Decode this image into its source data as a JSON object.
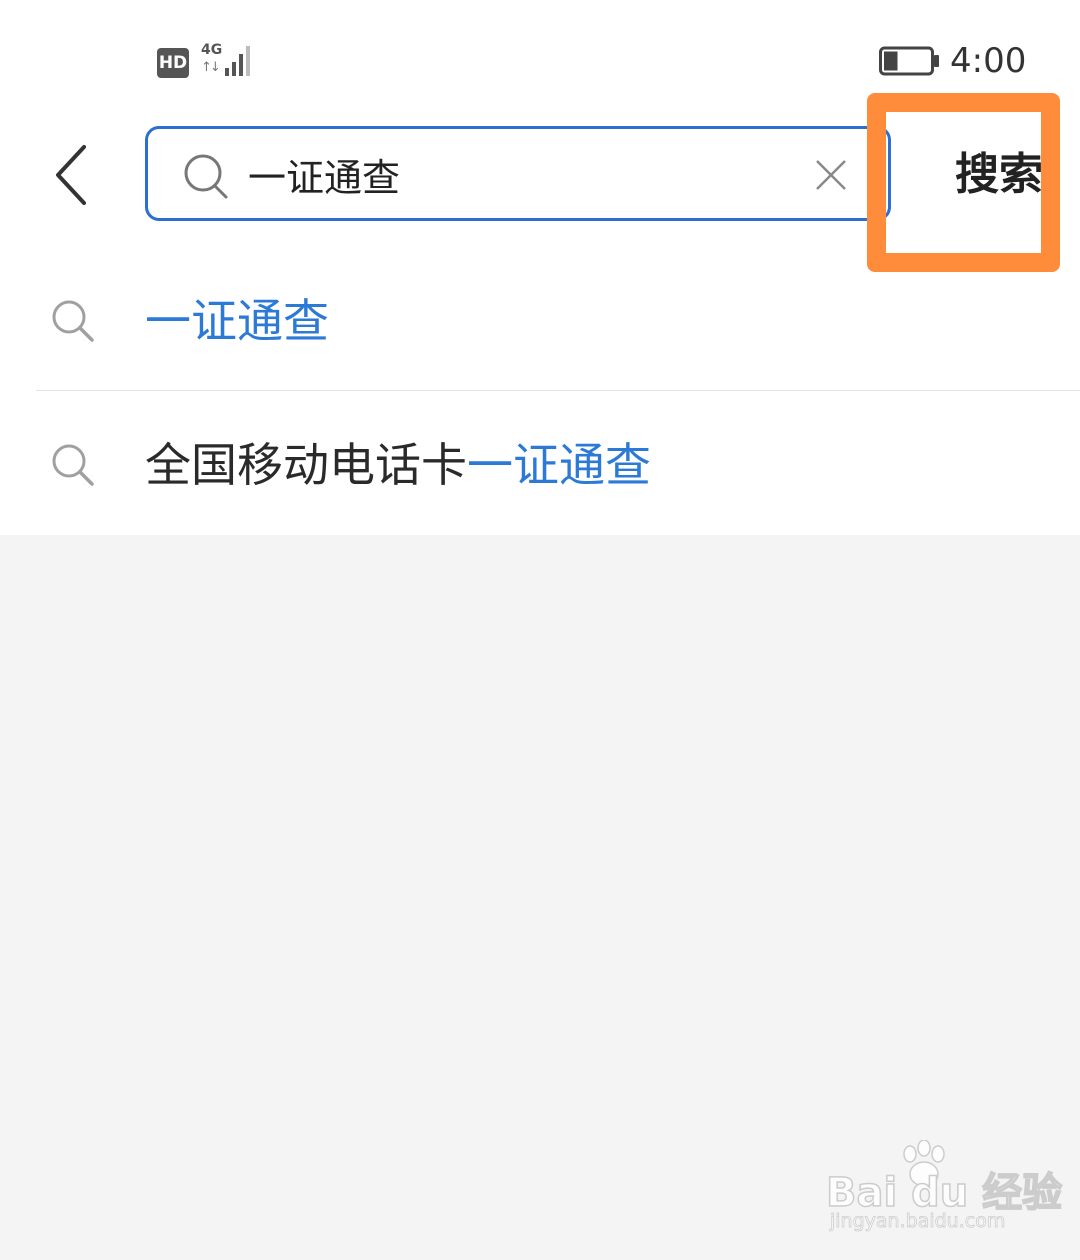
{
  "status_bar": {
    "hd_label": "HD",
    "network_type": "4G",
    "network_arrows": "↑↓",
    "time": "4:00",
    "battery_level": 0.3
  },
  "search": {
    "query": "一证通查",
    "search_button_label": "搜索",
    "accent_color": "#2d6fd0",
    "highlight_color": "#ff8c3a"
  },
  "suggestions": [
    {
      "prefix": "",
      "match": "一证通查"
    },
    {
      "prefix": "全国移动电话卡",
      "match": "一证通查"
    }
  ],
  "watermark": {
    "brand": "Bai du 经验",
    "url": "jingyan.baidu.com"
  },
  "icons": [
    "back-chevron-icon",
    "search-icon",
    "clear-x-icon",
    "signal-icon",
    "battery-icon"
  ]
}
